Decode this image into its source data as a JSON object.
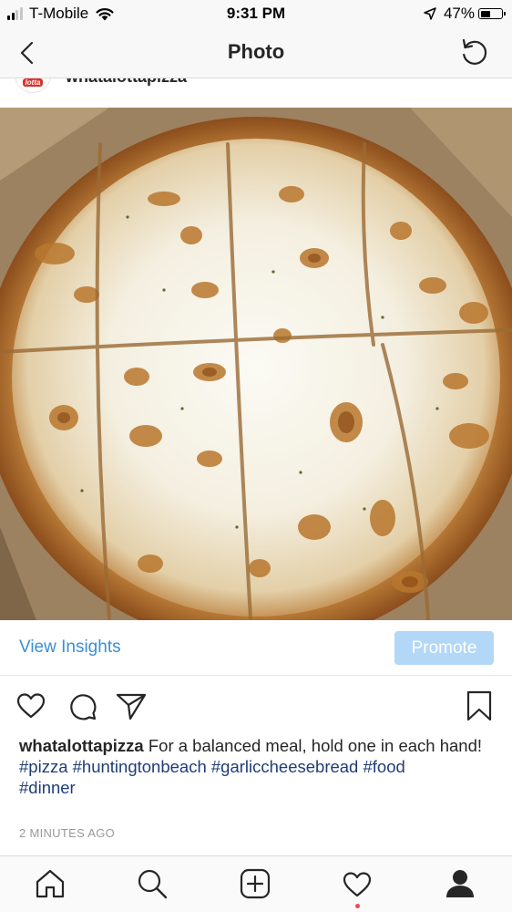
{
  "status_bar": {
    "carrier": "T-Mobile",
    "time": "9:31 PM",
    "battery_percent": "47%",
    "battery_level": 0.47,
    "signal_bars": 2,
    "signal_bars_total": 4
  },
  "nav": {
    "title": "Photo",
    "back_icon": "chevron-left-icon",
    "refresh_icon": "refresh-icon"
  },
  "post": {
    "username": "whatalottapizza",
    "avatar_text": "lotta",
    "photo_alt": "",
    "insights_label": "View Insights",
    "promote_label": "Promote",
    "caption_text": "For a balanced meal, hold one in each hand!",
    "hashtags": [
      "#pizza",
      "#huntingtonbeach",
      "#garliccheesebread",
      "#food",
      "#dinner"
    ],
    "timestamp": "2 MINUTES AGO"
  },
  "actions": [
    "heart-icon",
    "comment-icon",
    "share-icon",
    "bookmark-icon"
  ],
  "tab_bar": [
    "home-icon",
    "search-icon",
    "add-post-icon",
    "activity-icon",
    "profile-icon"
  ],
  "colors": {
    "link_blue": "#3b8fd6",
    "promote_bg": "#b3d7f7",
    "hashtag_blue": "#1f3d78",
    "notification_red": "#ed4956",
    "text": "#262626",
    "muted": "#999999"
  }
}
